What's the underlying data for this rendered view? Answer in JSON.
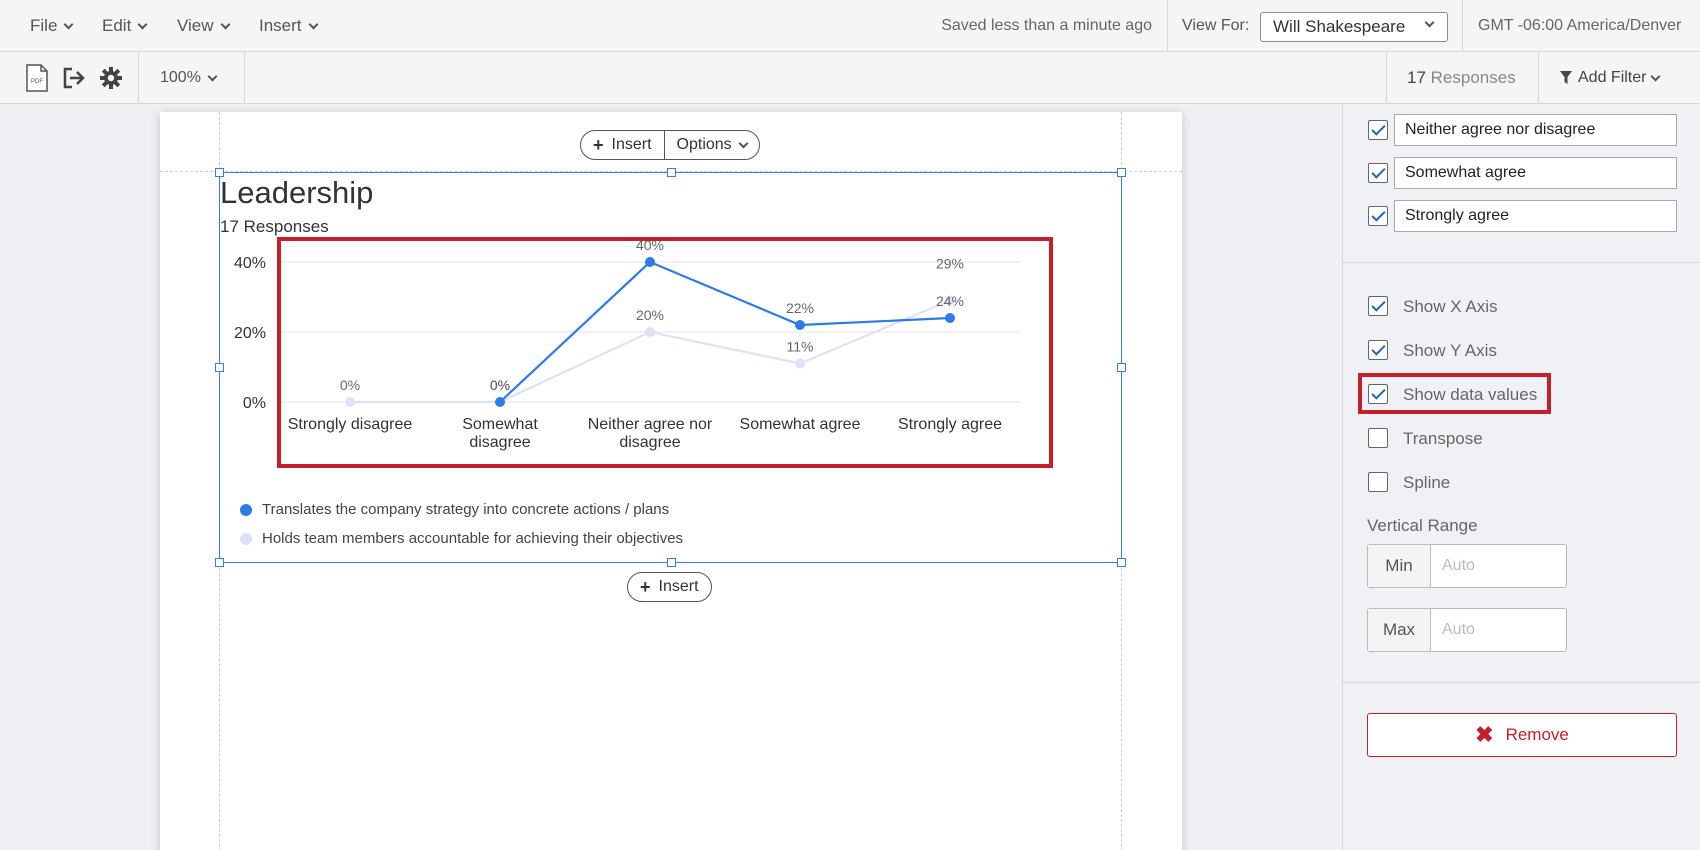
{
  "menu": {
    "file": "File",
    "edit": "Edit",
    "view": "View",
    "insert": "Insert",
    "saved_status": "Saved less than a minute ago",
    "view_for_label": "View For:",
    "view_for_value": "Will Shakespeare",
    "timezone": "GMT -06:00 America/Denver"
  },
  "toolbar": {
    "icons": [
      "pdf-icon",
      "export-icon",
      "gear-icon"
    ],
    "zoom": "100%",
    "responses_count": "17",
    "responses_label": "Responses",
    "add_filter": "Add Filter"
  },
  "page": {
    "insert_top": "Insert",
    "options": "Options",
    "insert_bottom": "Insert"
  },
  "widget": {
    "title": "Leadership",
    "subtitle": "17 Responses"
  },
  "chart_data": {
    "type": "line",
    "categories": [
      [
        "Strongly disagree"
      ],
      [
        "Somewhat",
        "disagree"
      ],
      [
        "Neither agree nor",
        "disagree"
      ],
      [
        "Somewhat agree"
      ],
      [
        "Strongly agree"
      ]
    ],
    "ylim": [
      0,
      40
    ],
    "yticks": [
      0,
      20,
      40
    ],
    "ytick_labels": [
      "0%",
      "20%",
      "40%"
    ],
    "show_data_values": true,
    "grid": true,
    "series": [
      {
        "name": "Translates the company strategy into concrete actions / plans",
        "color": "#2e7be8",
        "values": [
          null,
          0,
          40,
          22,
          24
        ],
        "labels": [
          "",
          "0%",
          "40%",
          "22%",
          "24%"
        ]
      },
      {
        "name": "Holds team members accountable for achieving their objectives",
        "color": "#dfe1f7",
        "values": [
          0,
          0,
          20,
          11,
          29
        ],
        "labels": [
          "0%",
          "0%",
          "20%",
          "11%",
          "29%"
        ]
      }
    ]
  },
  "panel": {
    "choices": [
      {
        "label": "Neither agree nor disagree",
        "checked": true
      },
      {
        "label": "Somewhat agree",
        "checked": true
      },
      {
        "label": "Strongly agree",
        "checked": true
      }
    ],
    "options": [
      {
        "label": "Show X Axis",
        "checked": true
      },
      {
        "label": "Show Y Axis",
        "checked": true
      },
      {
        "label": "Show data values",
        "checked": true
      },
      {
        "label": "Transpose",
        "checked": false
      },
      {
        "label": "Spline",
        "checked": false
      }
    ],
    "vertical_range_label": "Vertical Range",
    "min_label": "Min",
    "max_label": "Max",
    "min_placeholder": "Auto",
    "max_placeholder": "Auto",
    "remove": "Remove"
  }
}
